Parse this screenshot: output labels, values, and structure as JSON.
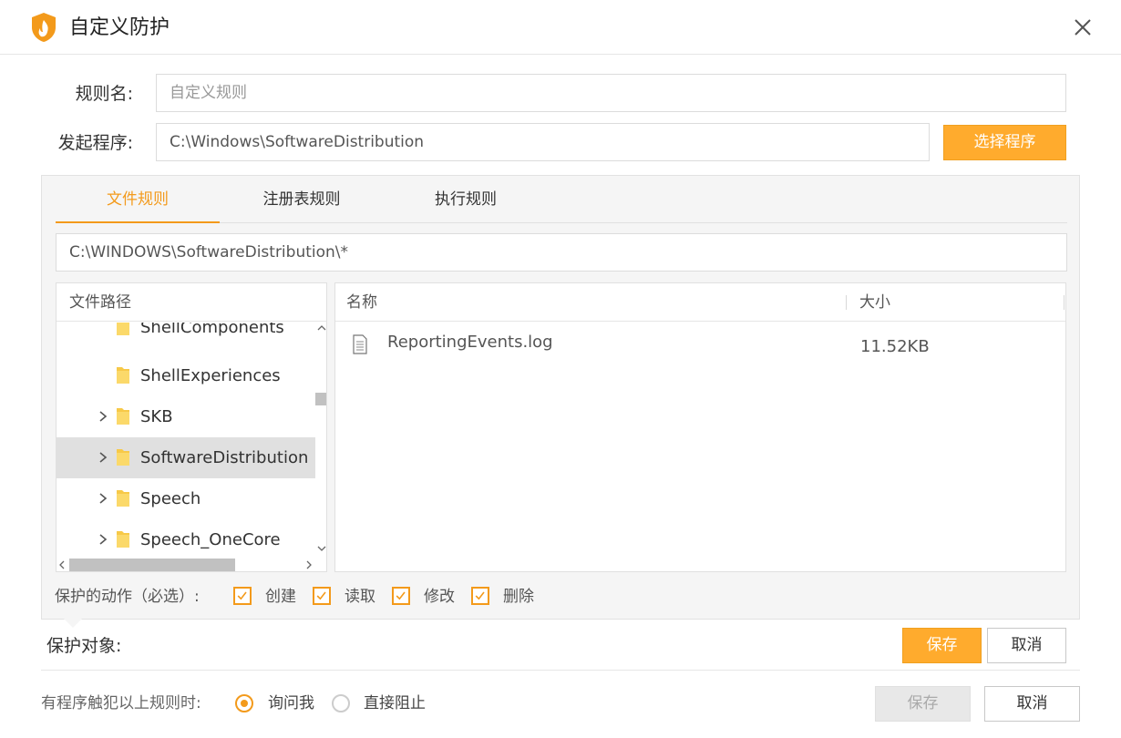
{
  "window": {
    "title": "自定义防护",
    "logo_icon": "shield-flame-logo",
    "close_icon": "close-icon"
  },
  "form": {
    "rule_name_label": "规则名:",
    "rule_name_placeholder": "自定义规则",
    "program_label": "发起程序:",
    "program_value": "C:\\Windows\\SoftwareDistribution",
    "select_program_button": "选择程序"
  },
  "tabs": [
    {
      "label": "文件规则",
      "active": true
    },
    {
      "label": "注册表规则",
      "active": false
    },
    {
      "label": "执行规则",
      "active": false
    }
  ],
  "path_value": "C:\\WINDOWS\\SoftwareDistribution\\*",
  "tree": {
    "header": "文件路径",
    "items": [
      {
        "label": "ShellComponents",
        "expandable": false,
        "selected": false
      },
      {
        "label": "ShellExperiences",
        "expandable": false,
        "selected": false
      },
      {
        "label": "SKB",
        "expandable": true,
        "selected": false
      },
      {
        "label": "SoftwareDistribution",
        "expandable": true,
        "selected": true
      },
      {
        "label": "Speech",
        "expandable": true,
        "selected": false
      },
      {
        "label": "Speech_OneCore",
        "expandable": true,
        "selected": false
      }
    ]
  },
  "file_list": {
    "col_name": "名称",
    "col_size": "大小",
    "rows": [
      {
        "name": "ReportingEvents.log",
        "size": "11.52KB",
        "icon": "document-icon"
      }
    ]
  },
  "actions": {
    "label": "保护的动作（必选）:",
    "options": [
      {
        "label": "创建",
        "checked": true
      },
      {
        "label": "读取",
        "checked": true
      },
      {
        "label": "修改",
        "checked": true
      },
      {
        "label": "删除",
        "checked": true
      }
    ]
  },
  "protect_target": {
    "label": "保护对象:",
    "save_button": "保存",
    "cancel_button": "取消"
  },
  "footer": {
    "label": "有程序触犯以上规则时:",
    "options": [
      {
        "label": "询问我",
        "checked": true
      },
      {
        "label": "直接阻止",
        "checked": false
      }
    ],
    "save_button": "保存",
    "cancel_button": "取消"
  },
  "colors": {
    "accent": "#f39a1b",
    "button_orange": "#ffab2d"
  }
}
